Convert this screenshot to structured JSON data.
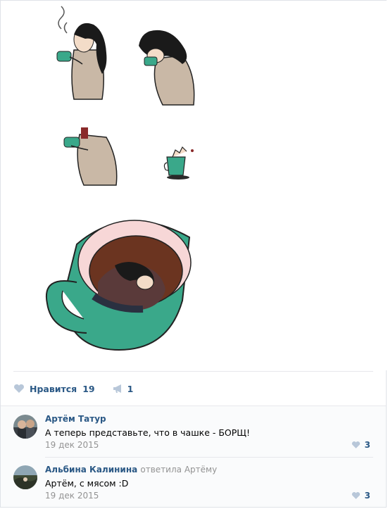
{
  "post": {
    "likes_label": "Нравится",
    "likes_count": "19",
    "shares_count": "1",
    "icons": {
      "like": "heart-icon",
      "share": "megaphone-icon"
    }
  },
  "comments": [
    {
      "author": "Артём Татур",
      "reply_to": "",
      "text": "А теперь представьте, что в чашке - БОРЩ!",
      "date": "19 дек 2015",
      "likes": "3"
    },
    {
      "author": "Альбина Калинина",
      "reply_to": "ответила Артёму",
      "text": "Артём, с мясом :D",
      "date": "19 дек 2015",
      "likes": "3"
    }
  ],
  "colors": {
    "link": "#2a5885",
    "muted": "#939393",
    "cup": "#3aa88a",
    "coffee": "#6b3420"
  }
}
